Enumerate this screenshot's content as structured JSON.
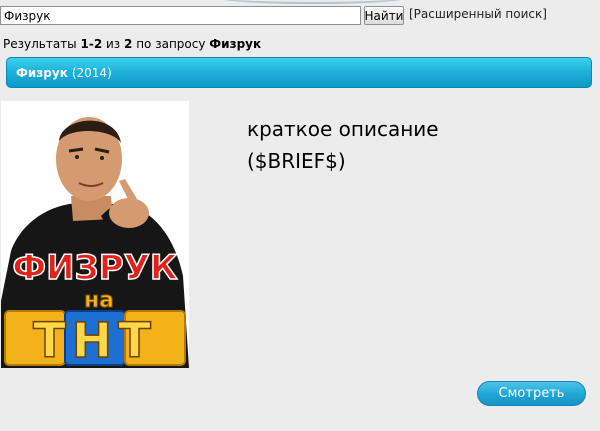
{
  "search": {
    "value": "Физрук",
    "button_label": "Найти",
    "advanced_link": "[Расширенный поиск]"
  },
  "results": {
    "prefix": "Результаты",
    "range": "1-2",
    "of_word": "из",
    "total": "2",
    "query_phrase": "по запросу",
    "query": "Физрук"
  },
  "item": {
    "title": "Физрук",
    "year": "(2014)",
    "poster_lettering": [
      "ФИЗРУК",
      "на",
      "ТНТ"
    ],
    "description_line1": "краткое описание",
    "description_line2": "($BRIEF$)",
    "watch_button": "Смотреть"
  },
  "colors": {
    "title_bar": "#1fb3dc",
    "watch_button": "#22a8d6",
    "poster_red": "#e0221b",
    "poster_gold": "#f3b21a",
    "poster_blue": "#1d6fd1"
  }
}
